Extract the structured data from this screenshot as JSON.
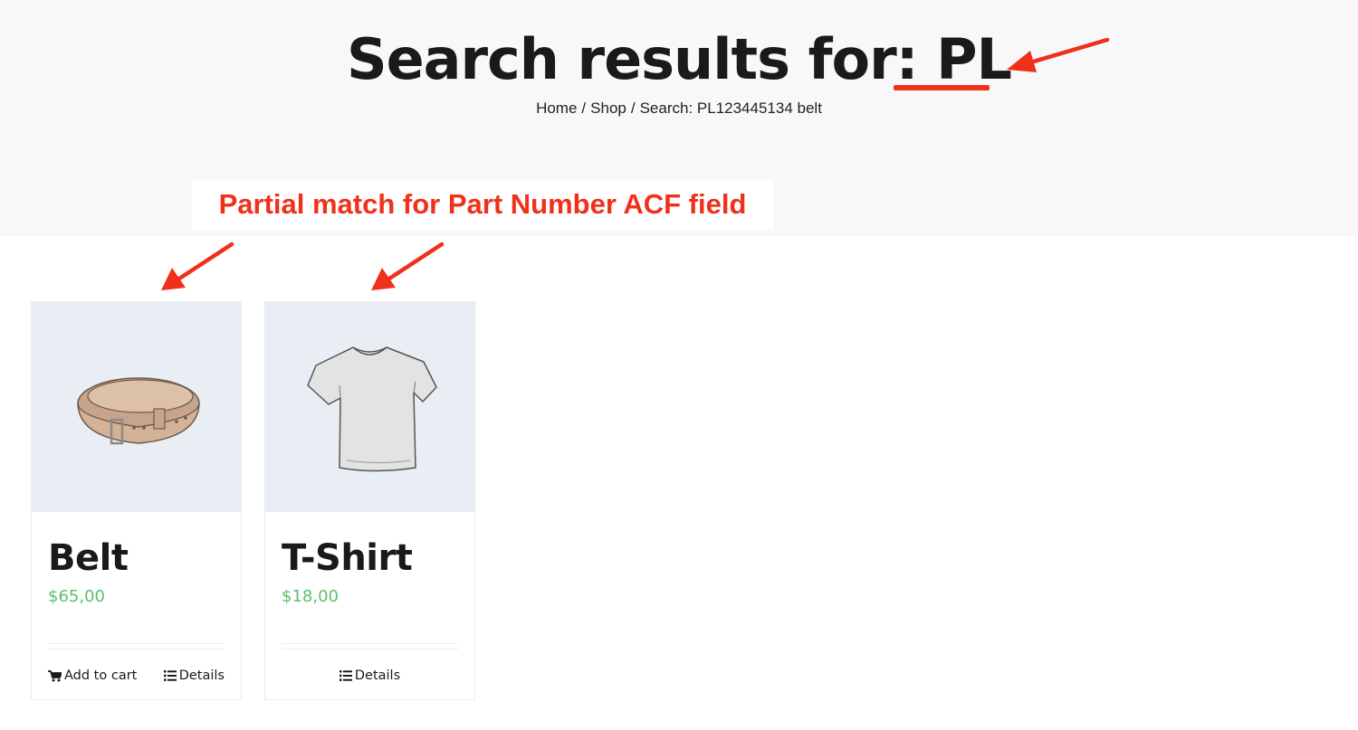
{
  "header": {
    "title_prefix": "Search results for: ",
    "title_term": "PL",
    "breadcrumb": [
      {
        "label": "Home"
      },
      {
        "label": "Shop"
      },
      {
        "label": "Search: PL123445134 belt"
      }
    ],
    "breadcrumb_separator": "/"
  },
  "annotation": {
    "label": "Partial match for Part Number ACF field",
    "color": "#f0301a"
  },
  "products": [
    {
      "name": "Belt",
      "price": "$65,00",
      "image_icon": "belt-image",
      "actions": [
        {
          "label": "Add to cart",
          "icon": "cart-icon"
        },
        {
          "label": "Details",
          "icon": "list-icon"
        }
      ]
    },
    {
      "name": "T-Shirt",
      "price": "$18,00",
      "image_icon": "tshirt-image",
      "actions": [
        {
          "label": "Details",
          "icon": "list-icon"
        }
      ]
    }
  ],
  "colors": {
    "price": "#5bbf6a",
    "hero_bg": "#f8f8fa",
    "thumb_bg": "#e8eef3"
  }
}
